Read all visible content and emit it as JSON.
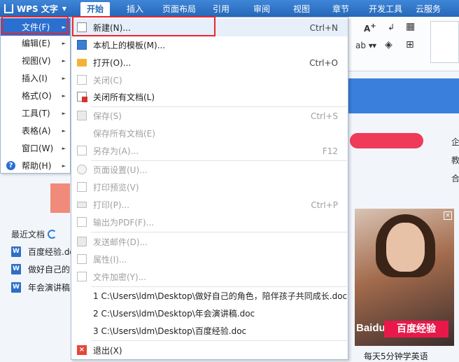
{
  "app": {
    "title": "WPS 文字"
  },
  "ribbon_tabs": [
    "开始",
    "插入",
    "页面布局",
    "引用",
    "审阅",
    "视图",
    "章节",
    "开发工具",
    "云服务"
  ],
  "ribbon": {
    "font_grow": "A",
    "ab": "ab"
  },
  "app_menu": {
    "items": [
      {
        "label": "文件(F)"
      },
      {
        "label": "编辑(E)"
      },
      {
        "label": "视图(V)"
      },
      {
        "label": "插入(I)"
      },
      {
        "label": "格式(O)"
      },
      {
        "label": "工具(T)"
      },
      {
        "label": "表格(A)"
      },
      {
        "label": "窗口(W)"
      },
      {
        "label": "帮助(H)"
      }
    ]
  },
  "file_menu": {
    "items": [
      {
        "label": "新建(N)...",
        "shortcut": "Ctrl+N",
        "icon": "new-doc-icon"
      },
      {
        "label": "本机上的模板(M)...",
        "shortcut": "",
        "icon": "template-icon"
      },
      {
        "label": "打开(O)...",
        "shortcut": "Ctrl+O",
        "icon": "open-folder-icon"
      },
      {
        "label": "关闭(C)",
        "shortcut": "",
        "icon": "close-doc-icon"
      },
      {
        "label": "关闭所有文档(L)",
        "shortcut": "",
        "icon": "close-all-icon"
      },
      {
        "label": "保存(S)",
        "shortcut": "Ctrl+S",
        "icon": "save-icon"
      },
      {
        "label": "保存所有文档(E)",
        "shortcut": "",
        "icon": ""
      },
      {
        "label": "另存为(A)...",
        "shortcut": "F12",
        "icon": "save-as-icon"
      },
      {
        "label": "页面设置(U)...",
        "shortcut": "",
        "icon": "page-setup-icon"
      },
      {
        "label": "打印预览(V)",
        "shortcut": "",
        "icon": "print-preview-icon"
      },
      {
        "label": "打印(P)...",
        "shortcut": "Ctrl+P",
        "icon": "printer-icon"
      },
      {
        "label": "输出为PDF(F)...",
        "shortcut": "",
        "icon": "pdf-icon"
      },
      {
        "label": "发送邮件(D)...",
        "shortcut": "",
        "icon": "mail-icon"
      },
      {
        "label": "属性(I)...",
        "shortcut": "",
        "icon": "properties-icon"
      },
      {
        "label": "文件加密(Y)...",
        "shortcut": "",
        "icon": "encrypt-icon"
      },
      {
        "label": "1 C:\\Users\\ldm\\Desktop\\做好自己的角色，陪伴孩子共同成长.doc",
        "shortcut": "",
        "icon": ""
      },
      {
        "label": "2 C:\\Users\\ldm\\Desktop\\年会演讲稿.doc",
        "shortcut": "",
        "icon": ""
      },
      {
        "label": "3 C:\\Users\\ldm\\Desktop\\百度经验.doc",
        "shortcut": "",
        "icon": ""
      },
      {
        "label": "退出(X)",
        "shortcut": "",
        "icon": "exit-icon"
      }
    ]
  },
  "recent": {
    "title": "最近文档",
    "items": [
      "百度经验.doc",
      "做好自己的角色",
      "年会演讲稿.doc"
    ]
  },
  "side_text": [
    "企",
    "教",
    "合"
  ],
  "ad": {
    "button": "百度经验",
    "logo": "Baidu",
    "caption": "每天5分钟学英语"
  },
  "colors": {
    "accent": "#2b6fd0",
    "annotation": "#e8262f"
  }
}
